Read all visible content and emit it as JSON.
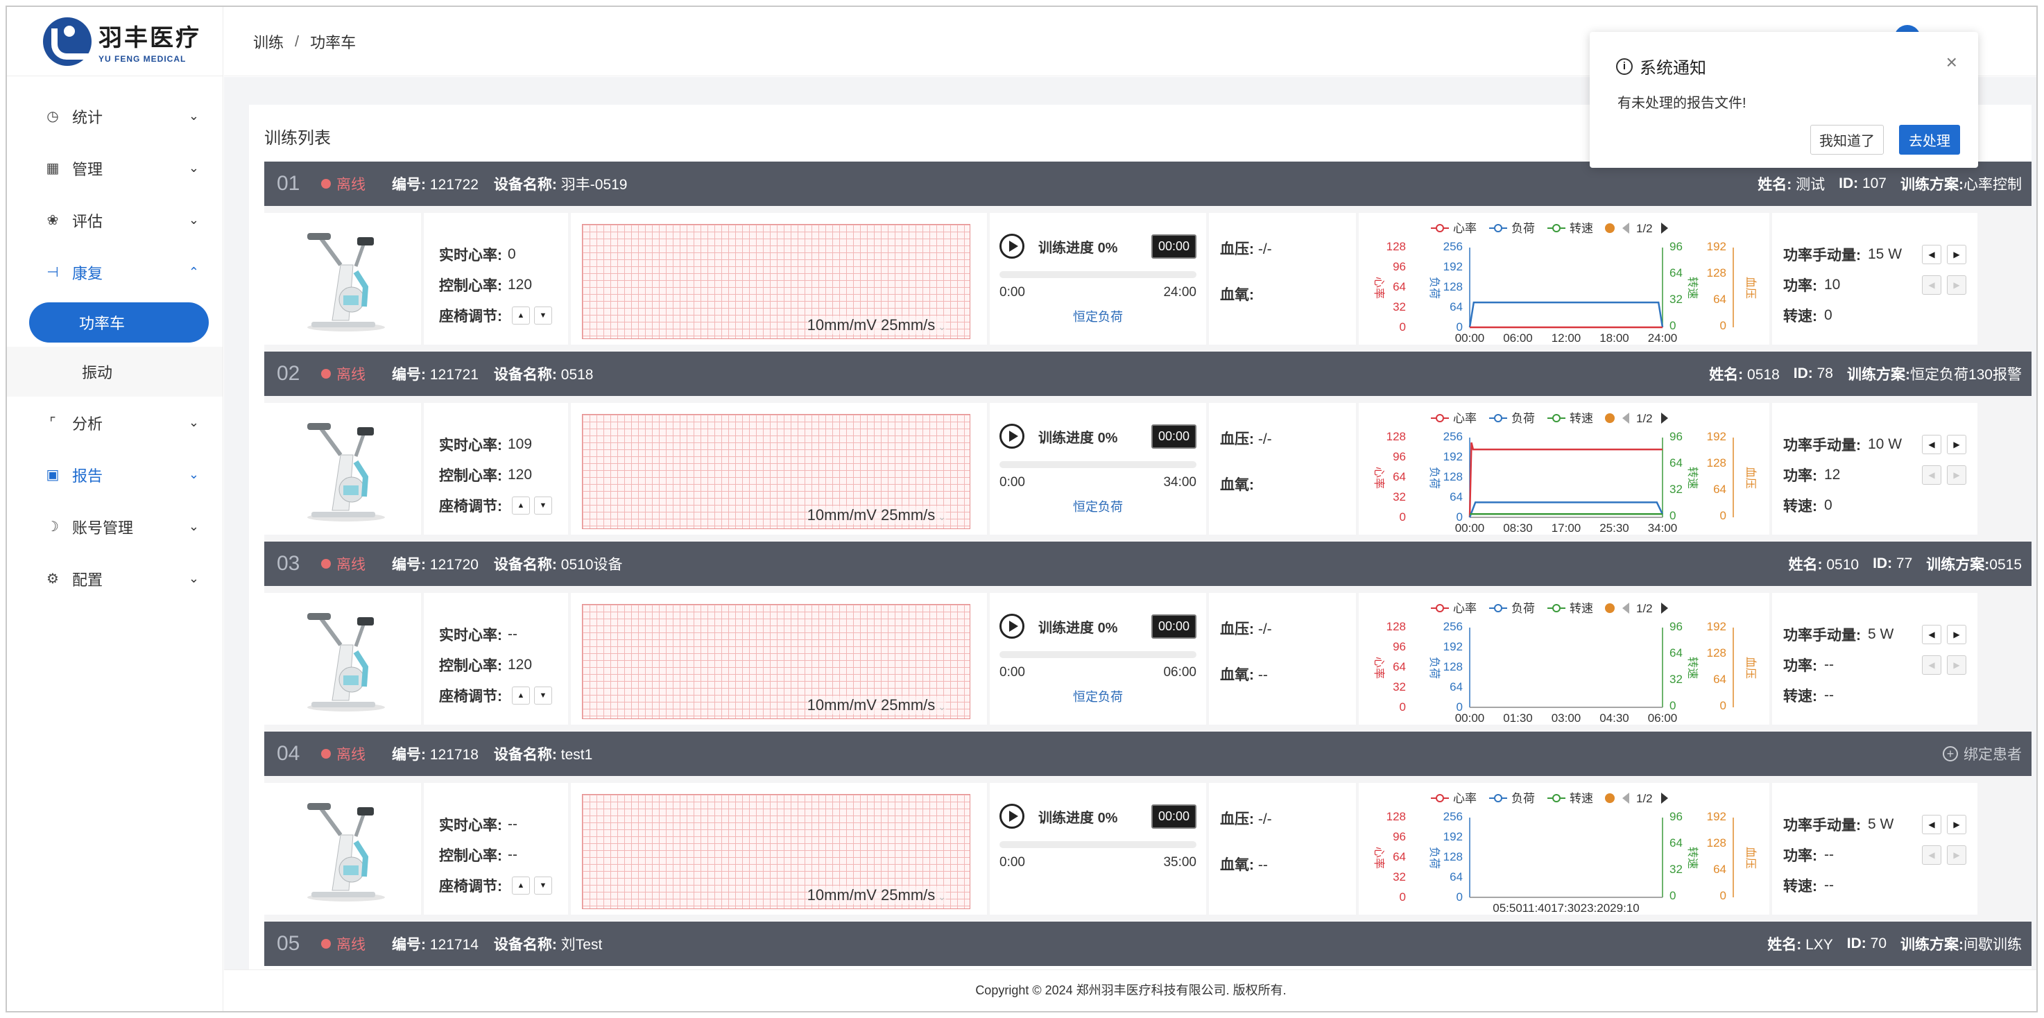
{
  "brand": {
    "name_cn": "羽丰医疗",
    "name_en": "YU FENG MEDICAL",
    "color": "#1f4e9a"
  },
  "accent": "#1f6cd0",
  "breadcrumb": {
    "root": "训练",
    "separator": "/",
    "current": "功率车"
  },
  "sidebar": {
    "items": [
      {
        "label": "统计",
        "icon": "clock-icon",
        "expanded": false
      },
      {
        "label": "管理",
        "icon": "grid-icon",
        "expanded": false
      },
      {
        "label": "评估",
        "icon": "brain-icon",
        "expanded": false
      },
      {
        "label": "康复",
        "icon": "dumbbell-icon",
        "expanded": true,
        "children": [
          {
            "label": "功率车",
            "selected": true
          },
          {
            "label": "振动",
            "selected": false
          }
        ]
      },
      {
        "label": "分析",
        "icon": "chart-icon",
        "expanded": false
      },
      {
        "label": "报告",
        "icon": "report-icon",
        "expanded": false
      },
      {
        "label": "账号管理",
        "icon": "account-icon",
        "expanded": false
      },
      {
        "label": "配置",
        "icon": "gear-icon",
        "expanded": false
      }
    ]
  },
  "panel_title": "训练列表",
  "labels": {
    "id_no": "编号:",
    "device_name": "设备名称:",
    "name": "姓名:",
    "id": "ID:",
    "plan": "训练方案:",
    "hr_realtime": "实时心率:",
    "hr_control": "控制心率:",
    "seat_adjust": "座椅调节:",
    "ecg_scale": "10mm/mV 25mm/s",
    "progress": "训练进度",
    "bp": "血压:",
    "spo2": "血氧:",
    "power_manual": "功率手动量:",
    "power": "功率:",
    "speed": "转速:",
    "bind_patient": "绑定患者",
    "legend_hr": "心率",
    "legend_load": "负荷",
    "legend_speed": "转速",
    "page": "1/2",
    "axis_hr": "心率",
    "axis_load": "负荷",
    "axis_speed": "转速",
    "axis_bp": "血压"
  },
  "chart_axes": {
    "hr_ticks": [
      "128",
      "96",
      "64",
      "32",
      "0"
    ],
    "load_ticks": [
      "256",
      "192",
      "128",
      "64",
      "0"
    ],
    "speed_ticks": [
      "96",
      "64",
      "32",
      "0"
    ],
    "bp_ticks": [
      "192",
      "128",
      "64",
      "0"
    ]
  },
  "colors": {
    "hr": "#d9363e",
    "load": "#2f74c0",
    "speed": "#3a9a3a",
    "bp": "#e08a2a",
    "head_bg": "#545964",
    "status_offline": "#e96f6f"
  },
  "devices": [
    {
      "num": "01",
      "status": "离线",
      "code": "121722",
      "device_name": "羽丰-0519",
      "patient": {
        "name": "测试",
        "id": "107",
        "plan": "心率控制"
      },
      "bound": true,
      "hr_realtime": "0",
      "hr_control": "120",
      "progress": "0%",
      "timer": "00:00",
      "time_start": "0:00",
      "time_end": "24:00",
      "mode": "恒定负荷",
      "bp": "-/-",
      "spo2": "",
      "power_manual": "15 W",
      "power": "10",
      "speed": "0",
      "chart_data": {
        "type": "line",
        "x_ticks": [
          "00:00",
          "06:00",
          "12:00",
          "18:00",
          "24:00"
        ],
        "series": [
          {
            "name": "负荷",
            "x": [
              0,
              0.5,
              2,
              22,
              23.5,
              24
            ],
            "y": [
              0,
              80,
              80,
              80,
              80,
              0
            ]
          },
          {
            "name": "心率",
            "x": [
              0,
              24
            ],
            "y": [
              0,
              0
            ]
          }
        ],
        "x_range": [
          0,
          24
        ],
        "load_range": [
          0,
          256
        ]
      }
    },
    {
      "num": "02",
      "status": "离线",
      "code": "121721",
      "device_name": "0518",
      "patient": {
        "name": "0518",
        "id": "78",
        "plan": "恒定负荷130报警"
      },
      "bound": true,
      "hr_realtime": "109",
      "hr_control": "120",
      "progress": "0%",
      "timer": "00:00",
      "time_start": "0:00",
      "time_end": "34:00",
      "mode": "恒定负荷",
      "bp": "-/-",
      "spo2": "",
      "power_manual": "10 W",
      "power": "12",
      "speed": "0",
      "chart_data": {
        "type": "line",
        "x_ticks": [
          "00:00",
          "08:30",
          "17:00",
          "25:30",
          "34:00"
        ],
        "series": [
          {
            "name": "心率",
            "x": [
              0,
              0.3,
              0.6,
              34
            ],
            "y": [
              0,
              120,
              109,
              109
            ]
          },
          {
            "name": "负荷",
            "x": [
              0,
              1,
              33,
              34
            ],
            "y": [
              0,
              48,
              48,
              10
            ]
          },
          {
            "name": "转速",
            "x": [
              0,
              34
            ],
            "y": [
              4,
              4
            ]
          }
        ],
        "x_range": [
          0,
          34
        ],
        "hr_range": [
          0,
          128
        ],
        "load_range": [
          0,
          256
        ]
      }
    },
    {
      "num": "03",
      "status": "离线",
      "code": "121720",
      "device_name": "0510设备",
      "patient": {
        "name": "0510",
        "id": "77",
        "plan": "0515"
      },
      "bound": true,
      "hr_realtime": "--",
      "hr_control": "120",
      "progress": "0%",
      "timer": "00:00",
      "time_start": "0:00",
      "time_end": "06:00",
      "mode": "恒定负荷",
      "bp": "-/-",
      "spo2": "--",
      "power_manual": "5 W",
      "power": "--",
      "speed": "--",
      "chart_data": {
        "type": "line",
        "x_ticks": [
          "00:00",
          "01:30",
          "03:00",
          "04:30",
          "06:00"
        ],
        "series": [],
        "x_range": [
          0,
          6
        ]
      }
    },
    {
      "num": "04",
      "status": "离线",
      "code": "121718",
      "device_name": "test1",
      "patient": null,
      "bound": false,
      "hr_realtime": "--",
      "hr_control": "--",
      "progress": "0%",
      "timer": "00:00",
      "time_start": "0:00",
      "time_end": "35:00",
      "mode": "",
      "bp": "-/-",
      "spo2": "--",
      "power_manual": "5 W",
      "power": "--",
      "speed": "--",
      "chart_data": {
        "type": "line",
        "x_ticks_text": "05:5011:4017:3023:2029:10",
        "series": [],
        "x_range": [
          0,
          35
        ]
      }
    },
    {
      "num": "05",
      "status": "离线",
      "code": "121714",
      "device_name": "刘Test",
      "patient": {
        "name": "LXY",
        "id": "70",
        "plan": "间歇训练"
      },
      "bound": true
    }
  ],
  "footer": "Copyright © 2024 郑州羽丰医疗科技有限公司. 版权所有.",
  "notification": {
    "title": "系统通知",
    "message": "有未处理的报告文件!",
    "ok_label": "我知道了",
    "go_label": "去处理"
  }
}
